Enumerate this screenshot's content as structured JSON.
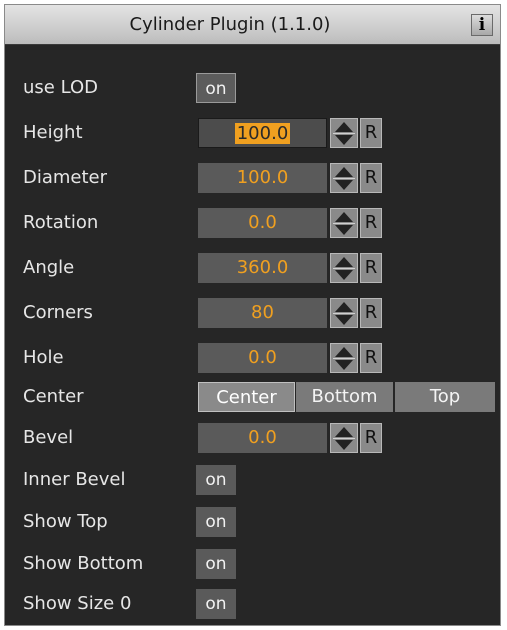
{
  "window": {
    "title": "Cylinder Plugin (1.1.0)",
    "info_label": "i"
  },
  "rows": {
    "use_lod": {
      "label": "use LOD",
      "value": "on"
    },
    "height": {
      "label": "Height",
      "value": "100.0"
    },
    "diameter": {
      "label": "Diameter",
      "value": "100.0"
    },
    "rotation": {
      "label": "Rotation",
      "value": "0.0"
    },
    "angle": {
      "label": "Angle",
      "value": "360.0"
    },
    "corners": {
      "label": "Corners",
      "value": "80"
    },
    "hole": {
      "label": "Hole",
      "value": "0.0"
    },
    "center": {
      "label": "Center",
      "options": [
        "Center",
        "Bottom",
        "Top"
      ],
      "selected": "Center"
    },
    "bevel": {
      "label": "Bevel",
      "value": "0.0"
    },
    "inner_bevel": {
      "label": "Inner Bevel",
      "value": "on"
    },
    "show_top": {
      "label": "Show Top",
      "value": "on"
    },
    "show_bottom": {
      "label": "Show Bottom",
      "value": "on"
    },
    "show_size_0": {
      "label": "Show Size 0",
      "value": "on"
    }
  },
  "reset_label": "R",
  "colors": {
    "panel_bg": "#262626",
    "value_text": "#f0a020",
    "field_bg": "#5a5a5a",
    "button_bg": "#8a8a8a"
  }
}
